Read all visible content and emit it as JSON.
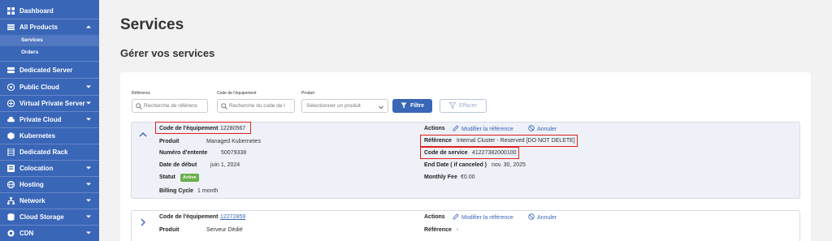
{
  "sidebar": {
    "items": [
      {
        "label": "Dashboard",
        "icon": "dashboard-icon"
      },
      {
        "label": "All Products",
        "icon": "products-icon"
      },
      {
        "label": "Dedicated Server",
        "icon": "server-icon"
      },
      {
        "label": "Public Cloud",
        "icon": "cloud-icon"
      },
      {
        "label": "Virtual Private Server",
        "icon": "vps-icon"
      },
      {
        "label": "Private Cloud",
        "icon": "private-cloud-icon"
      },
      {
        "label": "Kubernetes",
        "icon": "kubernetes-icon"
      },
      {
        "label": "Dedicated Rack",
        "icon": "rack-icon"
      },
      {
        "label": "Colocation",
        "icon": "colocation-icon"
      },
      {
        "label": "Hosting",
        "icon": "hosting-icon"
      },
      {
        "label": "Network",
        "icon": "network-icon"
      },
      {
        "label": "Cloud Storage",
        "icon": "storage-icon"
      },
      {
        "label": "CDN",
        "icon": "cdn-icon"
      }
    ],
    "sub_items": [
      {
        "label": "Services",
        "active": true
      },
      {
        "label": "Orders",
        "active": false
      }
    ]
  },
  "page": {
    "title": "Services",
    "subtitle": "Gérer vos services"
  },
  "filters": {
    "reference_label": "Référence",
    "reference_placeholder": "Recherche de référenc",
    "equipment_label": "Code de l'équipement",
    "equipment_placeholder": "Recherche du code de l",
    "product_label": "Produit",
    "product_placeholder": "Sélectionner un produit",
    "filter_button": "Filtre",
    "clear_button": "Effacer"
  },
  "services": [
    {
      "equipment_code_label": "Code de l'équipement",
      "equipment_code": "12280567",
      "product_label": "Produit",
      "product": "Managed Kubernetes",
      "entente_label": "Numéro d'entente",
      "entente": "50079338",
      "start_date_label": "Date de début",
      "start_date": "juin 1, 2024",
      "status_label": "Statut",
      "status": "Active",
      "billing_label": "Billing Cycle",
      "billing": "1 month",
      "actions_label": "Actions",
      "modify_action": "Modifier la référence",
      "cancel_action": "Annuler",
      "reference_label": "Référence",
      "reference": "Internal Cluster - Reserved [DO NOT DELETE]",
      "service_code_label": "Code de service",
      "service_code": "41227382000100",
      "end_date_label": "End Date ( if canceled )",
      "end_date": "nov. 30, 2025",
      "monthly_fee_label": "Monthly Fee",
      "monthly_fee": "€0.00"
    },
    {
      "equipment_code_label": "Code de l'équipement",
      "equipment_code": "12272859",
      "product_label": "Produit",
      "product": "Serveur Dédié",
      "actions_label": "Actions",
      "modify_action": "Modifier la référence",
      "cancel_action": "Annuler",
      "reference_label": "Référence",
      "reference": "-"
    }
  ],
  "colors": {
    "sidebar": "#3a66b8",
    "accent": "#3a66b8",
    "active_badge": "#6ab04c",
    "highlight": "#e02020"
  }
}
